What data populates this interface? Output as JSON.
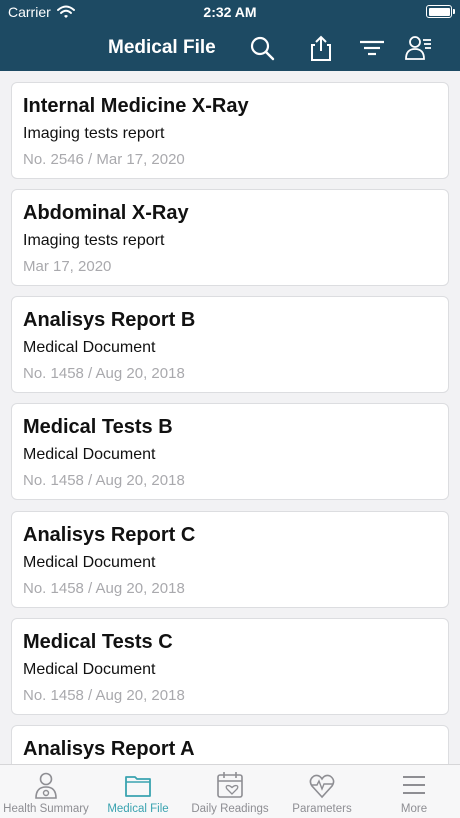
{
  "status_bar": {
    "carrier": "Carrier",
    "time": "2:32 AM"
  },
  "nav": {
    "title": "Medical File",
    "icons": [
      "search-icon",
      "share-icon",
      "filter-icon",
      "doctor-profile-icon"
    ]
  },
  "records": [
    {
      "title": "Internal Medicine X-Ray",
      "subtitle": "Imaging tests report",
      "meta": "No. 2546 / Mar 17, 2020"
    },
    {
      "title": "Abdominal X-Ray",
      "subtitle": "Imaging tests report",
      "meta": "Mar 17, 2020"
    },
    {
      "title": "Analisys Report B",
      "subtitle": "Medical Document",
      "meta": "No. 1458 / Aug 20, 2018"
    },
    {
      "title": "Medical Tests B",
      "subtitle": "Medical Document",
      "meta": "No. 1458 / Aug 20, 2018"
    },
    {
      "title": "Analisys Report C",
      "subtitle": "Medical Document",
      "meta": "No. 1458 / Aug 20, 2018"
    },
    {
      "title": "Medical Tests C",
      "subtitle": "Medical Document",
      "meta": "No. 1458 / Aug 20, 2018"
    },
    {
      "title": "Analisys Report A"
    }
  ],
  "tabs": [
    {
      "label": "Health Summary",
      "icon": "person-icon"
    },
    {
      "label": "Medical File",
      "icon": "folder-icon",
      "active": true
    },
    {
      "label": "Daily Readings",
      "icon": "calendar-heart-icon"
    },
    {
      "label": "Parameters",
      "icon": "heart-pulse-icon"
    },
    {
      "label": "More",
      "icon": "menu-icon"
    }
  ],
  "colors": {
    "header": "#1d4a63",
    "accent": "#3aa3b0",
    "inactive": "#8e8e93"
  }
}
